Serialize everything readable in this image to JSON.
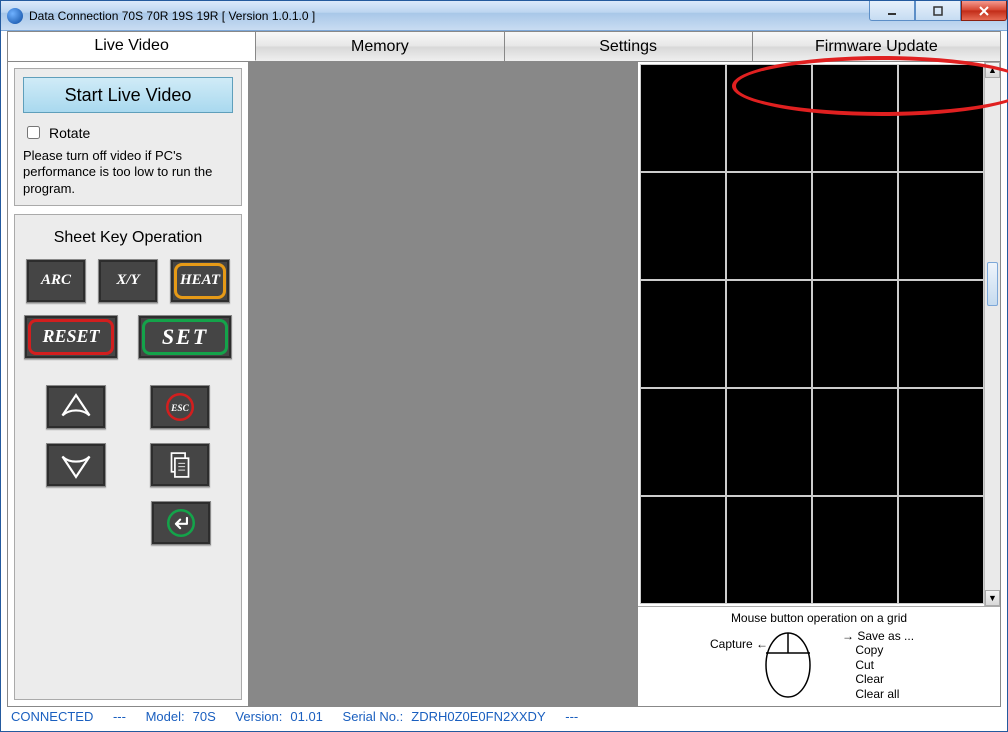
{
  "window": {
    "title": "Data Connection 70S 70R 19S 19R   [ Version 1.0.1.0 ]"
  },
  "tabs": {
    "live": "Live Video",
    "memory": "Memory",
    "settings": "Settings",
    "firmware": "Firmware Update"
  },
  "live_panel": {
    "start_button": "Start Live Video",
    "rotate_label": "Rotate",
    "hint": "Please turn off video if PC's performance is too low to run the program."
  },
  "sheetkey": {
    "title": "Sheet Key Operation",
    "arc": "ARC",
    "xy": "X/Y",
    "heat": "HEAT",
    "reset": "RESET",
    "set": "SET",
    "esc": "ESC"
  },
  "mouse_hint": {
    "title": "Mouse button operation on a grid",
    "capture": "Capture",
    "saveas": "Save as ...",
    "copy": "Copy",
    "cut": "Cut",
    "clear": "Clear",
    "clearall": "Clear all"
  },
  "status": {
    "connected": "CONNECTED",
    "sep": "---",
    "model_label": "Model:",
    "model": "70S",
    "version_label": "Version:",
    "version": "01.01",
    "serial_label": "Serial No.:",
    "serial": "ZDRH0Z0E0FN2XXDY"
  }
}
